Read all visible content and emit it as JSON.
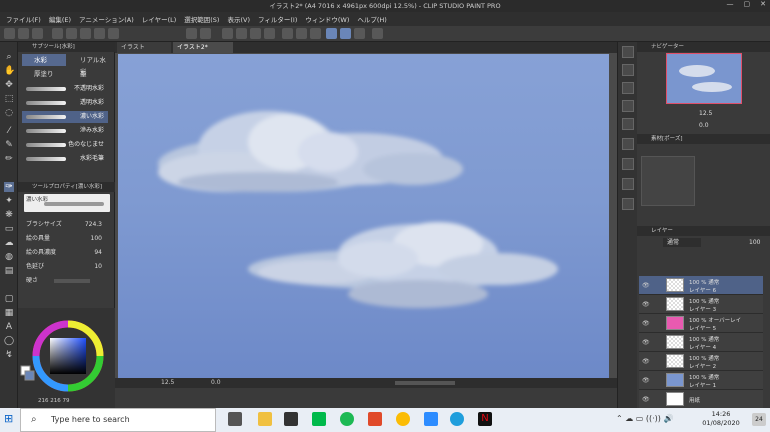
{
  "titlebar": {
    "title": "イラスト2* (A4 7016 x 4961px 600dpi 12.5%) - CLIP STUDIO PAINT PRO",
    "minimize": "—",
    "maximize": "▢",
    "close": "✕"
  },
  "menu": [
    "ファイル(F)",
    "編集(E)",
    "アニメーション(A)",
    "レイヤー(L)",
    "選択範囲(S)",
    "表示(V)",
    "フィルター(I)",
    "ウィンドウ(W)",
    "ヘルプ(H)"
  ],
  "subtool": {
    "header": "サブツール[水彩]",
    "tabs": [
      "水彩",
      "リアル水彩",
      "厚塗り",
      "墨"
    ],
    "brushes": [
      "不透明水彩",
      "透明水彩",
      "濃い水彩",
      "滲み水彩",
      "色のなじませ",
      "水彩毛筆"
    ]
  },
  "toolprop": {
    "header": "ツールプロパティ[濃い水彩]",
    "brush_name": "濃い水彩",
    "props": [
      {
        "label": "ブラシサイズ",
        "value": "724.3"
      },
      {
        "label": "絵の具量",
        "value": "100"
      },
      {
        "label": "絵の具濃度",
        "value": "94"
      },
      {
        "label": "色延び",
        "value": "10"
      },
      {
        "label": "硬さ",
        "value": ""
      }
    ]
  },
  "tabs": [
    "イラスト",
    "イラスト2*"
  ],
  "canvas_status": {
    "zoom": "12.5",
    "rotation": "0.0"
  },
  "color_status": "216 216 79",
  "navigator": {
    "header": "ナビゲーター",
    "zoom": "12.5",
    "angle": "0.0"
  },
  "panel2": {
    "header": "素材[ポーズ]"
  },
  "layers_panel": {
    "header": "レイヤー",
    "blend": "通常",
    "opacity": "100",
    "layers": [
      {
        "line1": "100 % 通常",
        "line2": "レイヤー 6"
      },
      {
        "line1": "100 % 通常",
        "line2": "レイヤー 3"
      },
      {
        "line1": "100 % オーバーレイ",
        "line2": "レイヤー 5"
      },
      {
        "line1": "100 % 通常",
        "line2": "レイヤー 4"
      },
      {
        "line1": "100 % 通常",
        "line2": "レイヤー 2"
      },
      {
        "line1": "100 % 通常",
        "line2": "レイヤー 1"
      },
      {
        "line1": "",
        "line2": "用紙"
      }
    ]
  },
  "taskbar": {
    "search_placeholder": "Type here to search",
    "time": "14:26",
    "date": "01/08/2020",
    "notif_count": "24"
  },
  "colors": {
    "canvas_sky": "#7f9ad1",
    "accent": "#56698f"
  }
}
